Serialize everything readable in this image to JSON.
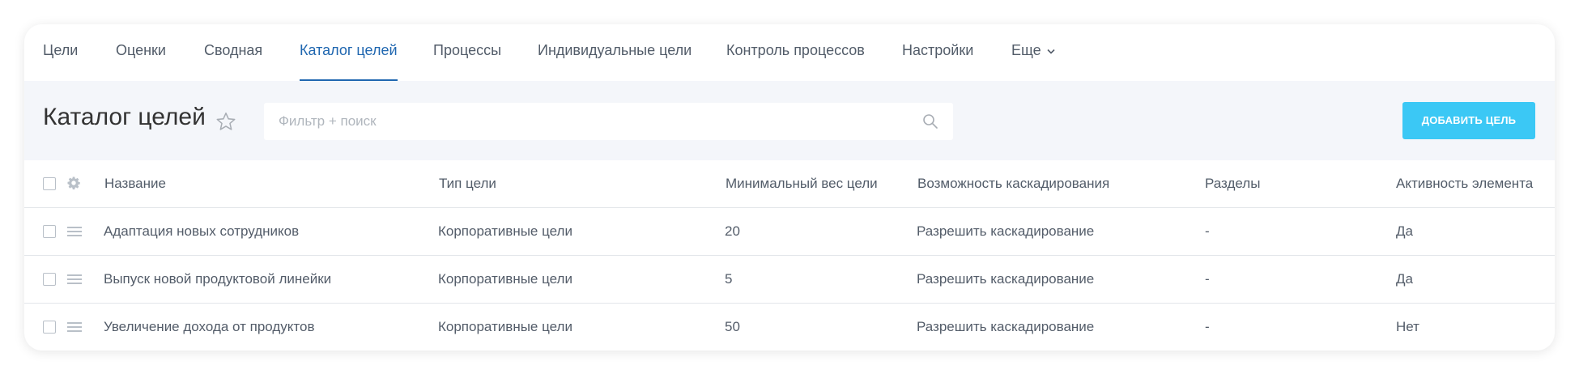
{
  "nav": {
    "items": [
      {
        "label": "Цели",
        "active": false
      },
      {
        "label": "Оценки",
        "active": false
      },
      {
        "label": "Сводная",
        "active": false
      },
      {
        "label": "Каталог целей",
        "active": true
      },
      {
        "label": "Процессы",
        "active": false
      },
      {
        "label": "Индивидуальные цели",
        "active": false
      },
      {
        "label": "Контроль процессов",
        "active": false
      },
      {
        "label": "Настройки",
        "active": false
      },
      {
        "label": "Еще",
        "active": false,
        "icon": "chevron-down-icon"
      }
    ]
  },
  "toolbar": {
    "title": "Каталог целей",
    "favorite_icon": "star-icon",
    "search_placeholder": "Фильтр + поиск",
    "search_value": "",
    "search_icon": "search-icon",
    "add_button_label": "ДОБАВИТЬ ЦЕЛЬ"
  },
  "table": {
    "settings_icon": "gear-icon",
    "row_menu_icon": "hamburger-icon",
    "columns": [
      "Название",
      "Тип цели",
      "Минимальный вес цели",
      "Возможность каскадирования",
      "Разделы",
      "Активность элемента"
    ],
    "rows": [
      [
        "Адаптация новых сотрудников",
        "Корпоративные цели",
        "20",
        "Разрешить каскадирование",
        "-",
        "Да"
      ],
      [
        "Выпуск новой продуктовой линейки",
        "Корпоративные цели",
        "5",
        "Разрешить каскадирование",
        "-",
        "Да"
      ],
      [
        "Увеличение дохода от продуктов",
        "Корпоративные цели",
        "50",
        "Разрешить каскадирование",
        "-",
        "Нет"
      ]
    ]
  },
  "colors": {
    "accent": "#2067b0",
    "button": "#3bc8f5",
    "background": "#f4f6fa"
  }
}
